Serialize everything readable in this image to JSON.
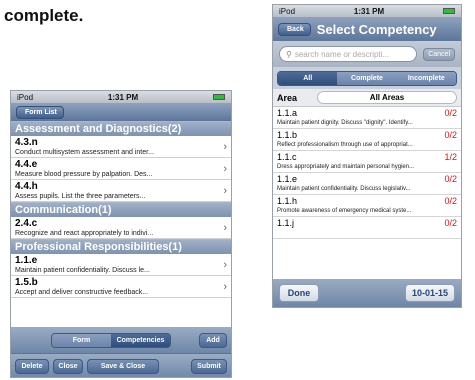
{
  "fragment_text": "complete.",
  "left": {
    "status": {
      "carrier": "iPod",
      "time": "1:31 PM"
    },
    "back_label": "Form List",
    "sections": [
      {
        "title": "Assessment and Diagnostics(2)",
        "rows": [
          {
            "code": "4.3.n",
            "desc": "Conduct multisystem assessment and inter..."
          },
          {
            "code": "4.4.e",
            "desc": "Measure blood pressure by palpation.  Des..."
          },
          {
            "code": "4.4.h",
            "desc": "Assess pupils.  List the three parameters..."
          }
        ]
      },
      {
        "title": "Communication(1)",
        "rows": [
          {
            "code": "2.4.c",
            "desc": "Recognize and react appropriately to indivi..."
          }
        ]
      },
      {
        "title": "Professional Responsibilities(1)",
        "rows": [
          {
            "code": "1.1.e",
            "desc": "Maintain patient confidentiality.  Discuss le..."
          },
          {
            "code": "1.5.b",
            "desc": "Accept and deliver constructive feedback..."
          }
        ]
      }
    ],
    "seg": [
      "Form",
      "Competencies"
    ],
    "add": "Add",
    "bottom": [
      "Delete",
      "Close",
      "Save & Close",
      "Submit"
    ]
  },
  "right": {
    "status": {
      "carrier": "iPod",
      "time": "1:31 PM"
    },
    "back_label": "Back",
    "title": "Select Competency",
    "search_placeholder": "search name or descripti...",
    "cancel": "Cancel",
    "filters": [
      "All",
      "Complete",
      "Incomplete"
    ],
    "area_label": "Area",
    "area_value": "All Areas",
    "rows": [
      {
        "code": "1.1.a",
        "count": "0/2",
        "desc": "Maintain patient dignity. Discuss \"dignity\". Identify..."
      },
      {
        "code": "1.1.b",
        "count": "0/2",
        "desc": "Reflect professionalism through use of appropriat..."
      },
      {
        "code": "1.1.c",
        "count": "1/2",
        "desc": "Dress appropriately and maintain personal hygien..."
      },
      {
        "code": "1.1.e",
        "count": "0/2",
        "desc": "Maintain patient confidentiality. Discuss legislativ..."
      },
      {
        "code": "1.1.h",
        "count": "0/2",
        "desc": "Promote awareness of emergency medical syste..."
      },
      {
        "code": "1.1.j",
        "count": "0/2",
        "desc": ""
      }
    ],
    "done": "Done",
    "date": "10-01-15"
  }
}
